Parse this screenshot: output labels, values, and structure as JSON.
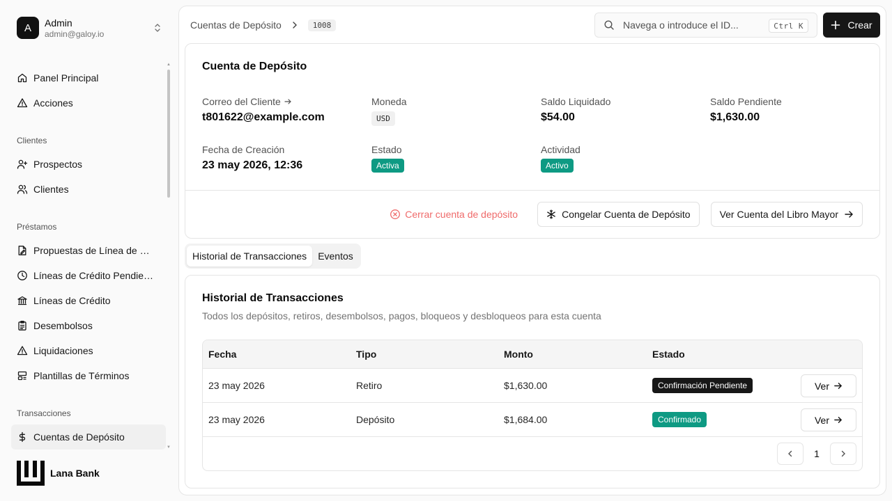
{
  "user": {
    "initial": "A",
    "name": "Admin",
    "email": "admin@galoy.io"
  },
  "nav": {
    "top": [
      {
        "label": "Panel Principal",
        "icon": "home-icon"
      },
      {
        "label": "Acciones",
        "icon": "alert-triangle-icon"
      }
    ],
    "groups": [
      {
        "label": "Clientes",
        "items": [
          {
            "label": "Prospectos",
            "icon": "user-plus-icon"
          },
          {
            "label": "Clientes",
            "icon": "users-icon"
          }
        ]
      },
      {
        "label": "Préstamos",
        "items": [
          {
            "label": "Propuestas de Línea de Cr...",
            "icon": "file-edit-icon"
          },
          {
            "label": "Líneas de Crédito Pendient...",
            "icon": "clock-icon"
          },
          {
            "label": "Líneas de Crédito",
            "icon": "bank-icon"
          },
          {
            "label": "Desembolsos",
            "icon": "clipboard-icon"
          },
          {
            "label": "Liquidaciones",
            "icon": "alert-triangle-icon"
          },
          {
            "label": "Plantillas de Términos",
            "icon": "layout-icon"
          }
        ]
      },
      {
        "label": "Transacciones",
        "items": [
          {
            "label": "Cuentas de Depósito",
            "icon": "dollar-icon",
            "active": true
          }
        ]
      }
    ]
  },
  "brand": {
    "name": "Lana Bank"
  },
  "breadcrumb": {
    "parent": "Cuentas de Depósito",
    "id": "1008"
  },
  "search": {
    "placeholder": "Navega o introduce el ID...",
    "shortcut": "Ctrl K"
  },
  "create": {
    "label": "Crear"
  },
  "details": {
    "title": "Cuenta de Depósito",
    "fields": {
      "email_label": "Correo del Cliente",
      "email_value": "t801622@example.com",
      "currency_label": "Moneda",
      "currency_value": "USD",
      "settled_label": "Saldo Liquidado",
      "settled_value": "$54.00",
      "pending_label": "Saldo Pendiente",
      "pending_value": "$1,630.00",
      "created_label": "Fecha de Creación",
      "created_value": "23 may 2026, 12:36",
      "status_label": "Estado",
      "status_value": "Activa",
      "activity_label": "Actividad",
      "activity_value": "Activo"
    },
    "actions": {
      "close": "Cerrar cuenta de depósito",
      "freeze": "Congelar Cuenta de Depósito",
      "ledger": "Ver Cuenta del Libro Mayor"
    }
  },
  "tabs": {
    "history": "Historial de Transacciones",
    "events": "Eventos"
  },
  "transactions": {
    "title": "Historial de Transacciones",
    "subtitle": "Todos los depósitos, retiros, desembolsos, pagos, bloqueos y desbloqueos para esta cuenta",
    "columns": {
      "date": "Fecha",
      "type": "Tipo",
      "amount": "Monto",
      "status": "Estado"
    },
    "rows": [
      {
        "date": "23 may 2026",
        "type": "Retiro",
        "amount": "$1,630.00",
        "status": "Confirmación Pendiente",
        "view": "Ver"
      },
      {
        "date": "23 may 2026",
        "type": "Depósito",
        "amount": "$1,684.00",
        "status": "Confirmado",
        "view": "Ver"
      }
    ],
    "page": "1"
  },
  "colors": {
    "accent_green": "#0e9a83",
    "danger": "#ef6a6a",
    "dark": "#171717"
  }
}
